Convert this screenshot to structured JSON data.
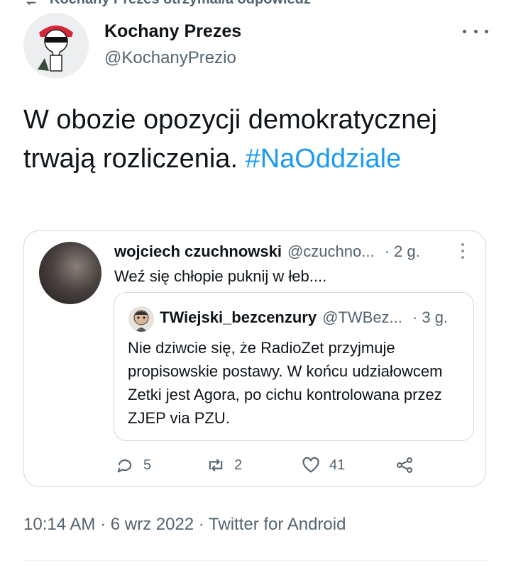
{
  "context": {
    "text": "Kochany Prezes otrzymał/a odpowiedź"
  },
  "author": {
    "name": "Kochany Prezes",
    "handle": "@KochanyPrezio"
  },
  "tweet": {
    "text": "W obozie opozycji demokratycznej trwają rozliczenia.",
    "hashtag": "#NaOddziale"
  },
  "quote": {
    "name": "wojciech czuchnowski",
    "handle": "@czuchno...",
    "time": "· 2 g.",
    "text": "Weź się chłopie puknij w łeb....",
    "inner": {
      "name": "TWiejski_bezcenzury",
      "handle": "@TWBez...",
      "time": "· 3 g.",
      "text": "Nie dziwcie się, że RadioZet przyjmuje propisowskie postawy. W końcu udziałowcem Zetki jest Agora, po cichu kontrolowana przez ZJEP via PZU."
    },
    "actions": {
      "replies": "5",
      "retweets": "2",
      "likes": "41"
    }
  },
  "meta": {
    "timestamp": "10:14 AM · 6 wrz 2022 · Twitter for Android"
  },
  "colors": {
    "link": "#1d9bf0",
    "muted": "#536471",
    "border": "#cfd9de"
  }
}
